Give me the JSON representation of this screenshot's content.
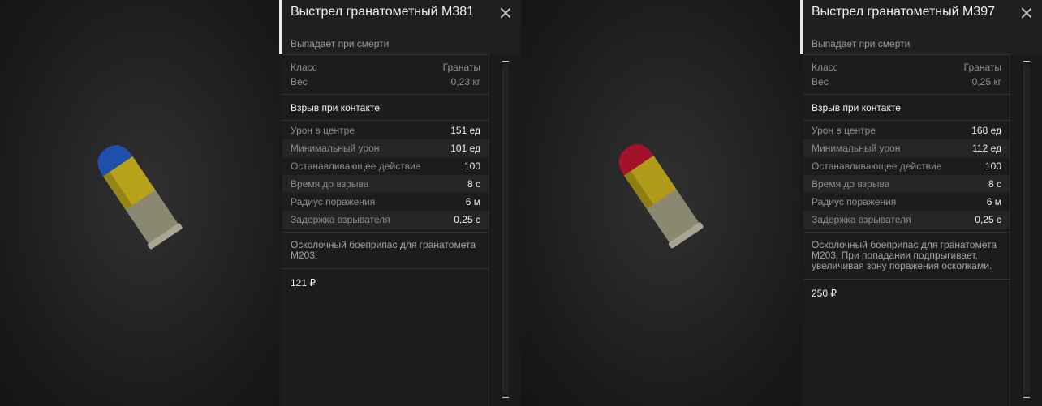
{
  "items": [
    {
      "title": "Выстрел гранатометный М381",
      "subtitle": "Выпадает при смерти",
      "basic": [
        {
          "label": "Класс",
          "value": "Гранаты"
        },
        {
          "label": "Вес",
          "value": "0,23 кг"
        }
      ],
      "fuze": "Взрыв при контакте",
      "stats": [
        {
          "label": "Урон в центре",
          "value": "151 ед"
        },
        {
          "label": "Минимальный урон",
          "value": "101 ед"
        },
        {
          "label": "Останавливающее действие",
          "value": "100"
        },
        {
          "label": "Время до взрыва",
          "value": "8 с"
        },
        {
          "label": "Радиус поражения",
          "value": "6 м"
        },
        {
          "label": "Задержка взрывателя",
          "value": "0,25 с"
        }
      ],
      "description": "Осколочный боеприпас для гранатомета М203.",
      "price": "121 ₽",
      "tip_color": "#1f4fa8",
      "body_color": "#b8a21c"
    },
    {
      "title": "Выстрел гранатометный М397",
      "subtitle": "Выпадает при смерти",
      "basic": [
        {
          "label": "Класс",
          "value": "Гранаты"
        },
        {
          "label": "Вес",
          "value": "0,25 кг"
        }
      ],
      "fuze": "Взрыв при контакте",
      "stats": [
        {
          "label": "Урон в центре",
          "value": "168 ед"
        },
        {
          "label": "Минимальный урон",
          "value": "112 ед"
        },
        {
          "label": "Останавливающее действие",
          "value": "100"
        },
        {
          "label": "Время до взрыва",
          "value": "8 с"
        },
        {
          "label": "Радиус поражения",
          "value": "6 м"
        },
        {
          "label": "Задержка взрывателя",
          "value": "0,25 с"
        }
      ],
      "description": "Осколочный боеприпас для гранатомета М203. При попадании подпрыгивает, увеличивая зону поражения осколками.",
      "price": "250 ₽",
      "tip_color": "#a3122a",
      "body_color": "#b09a1a"
    }
  ]
}
